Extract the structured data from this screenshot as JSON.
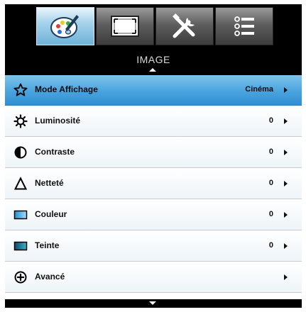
{
  "tabs": [
    {
      "icon": "palette-icon",
      "active": true
    },
    {
      "icon": "screen-frame-icon",
      "active": false
    },
    {
      "icon": "tools-icon",
      "active": false
    },
    {
      "icon": "list-icon",
      "active": false
    }
  ],
  "menu": {
    "title": "IMAGE",
    "items": [
      {
        "label": "Mode Affichage",
        "value": "Cinéma",
        "icon": "star-icon",
        "selected": true
      },
      {
        "label": "Luminosité",
        "value": "0",
        "icon": "brightness-icon",
        "selected": false
      },
      {
        "label": "Contraste",
        "value": "0",
        "icon": "contrast-icon",
        "selected": false
      },
      {
        "label": "Netteté",
        "value": "0",
        "icon": "sharpness-icon",
        "selected": false
      },
      {
        "label": "Couleur",
        "value": "0",
        "icon": "color-icon",
        "selected": false
      },
      {
        "label": "Teinte",
        "value": "0",
        "icon": "tint-icon",
        "selected": false
      },
      {
        "label": "Avancé",
        "value": "",
        "icon": "advanced-icon",
        "selected": false
      }
    ]
  },
  "colors": {
    "selected_row": "#49a3de",
    "active_tab": "#a7d3ea",
    "background": "#000000"
  }
}
